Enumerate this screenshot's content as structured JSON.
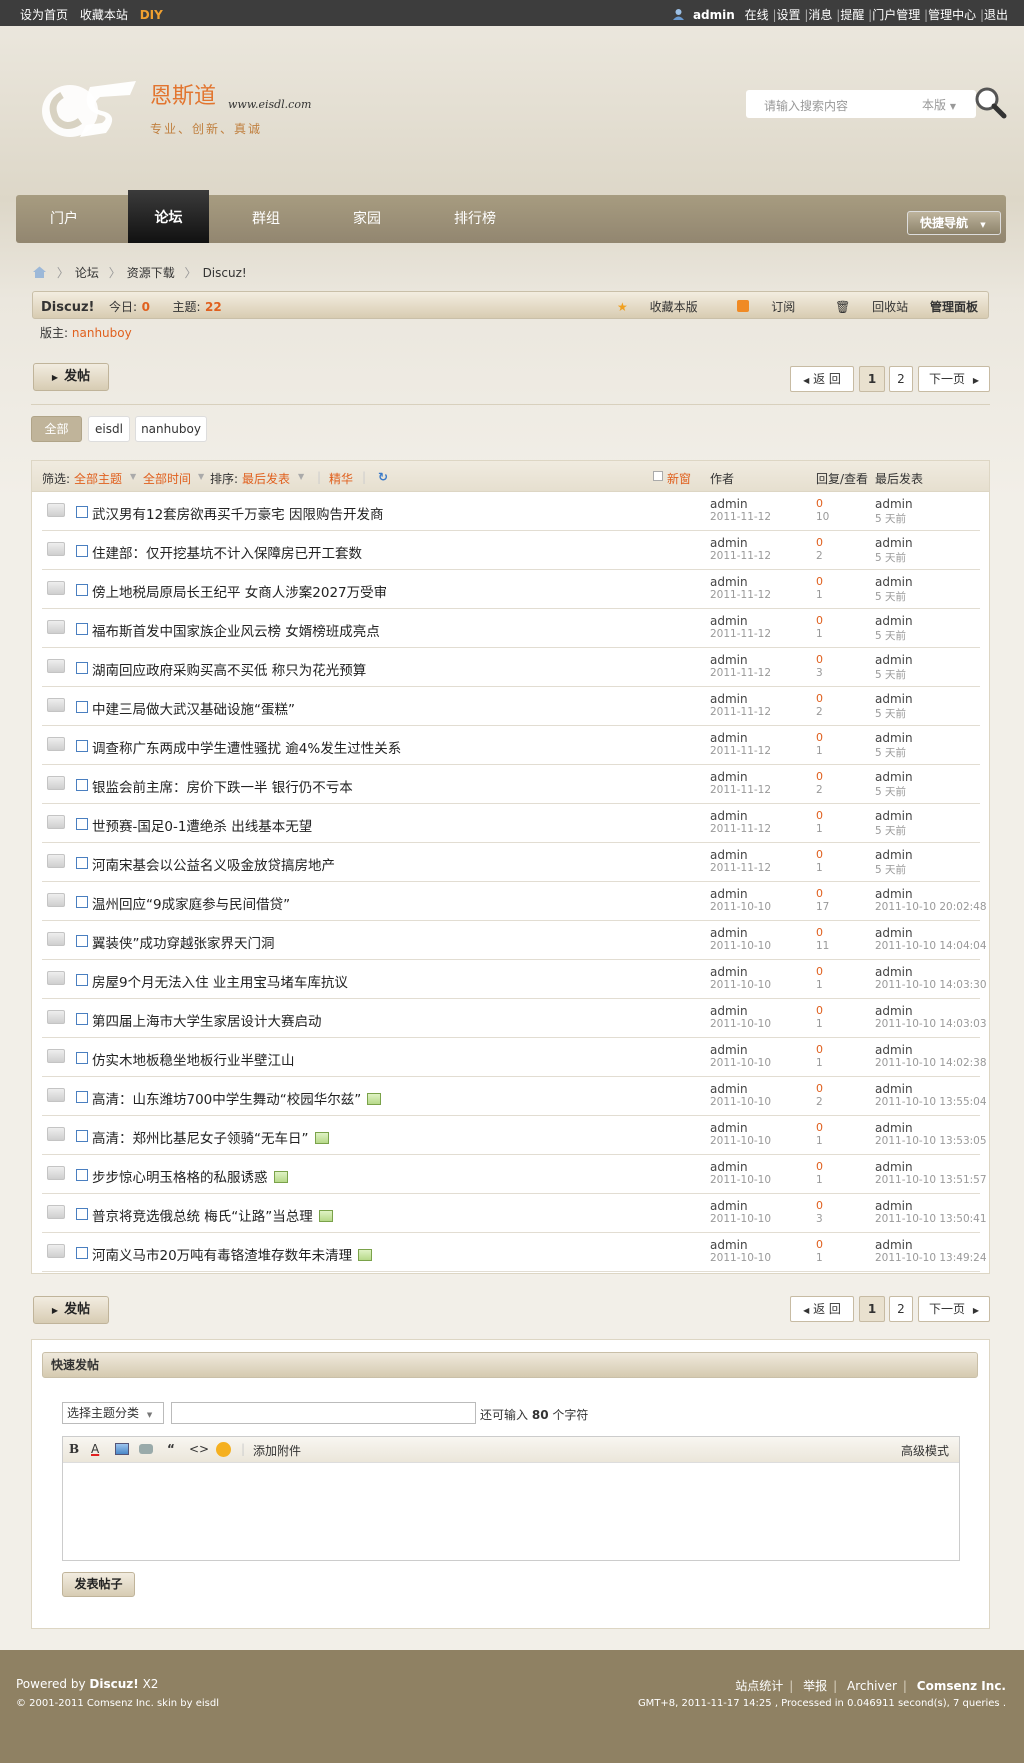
{
  "topbar": {
    "left": [
      "设为首页",
      "收藏本站"
    ],
    "diy": "DIY",
    "username": "admin",
    "status": "在线",
    "links": [
      "设置",
      "消息",
      "提醒",
      "门户管理",
      "管理中心",
      "退出"
    ]
  },
  "header": {
    "site_name": "恩斯道",
    "site_url": "www.eisdl.com",
    "slogan": "专业、创新、真诚",
    "search_placeholder": "请输入搜索内容",
    "search_scope": "本版"
  },
  "nav": {
    "items": [
      "门户",
      "论坛",
      "群组",
      "家园",
      "排行榜"
    ],
    "active": "论坛",
    "quick_nav": "快捷导航"
  },
  "breadcrumb": [
    "论坛",
    "资源下载",
    "Discuz!"
  ],
  "forum": {
    "name": "Discuz!",
    "today_label": "今日:",
    "today": "0",
    "threads_label": "主题:",
    "threads": "22",
    "tools": [
      "收藏本版",
      "订阅",
      "回收站",
      "管理面板"
    ],
    "moderator_label": "版主:",
    "moderator": "nanhuboy"
  },
  "actions": {
    "post": "发帖",
    "back": "返 回",
    "pages": [
      "1",
      "2"
    ],
    "next": "下一页"
  },
  "filter_tabs": [
    "全部",
    "eisdl",
    "nanhuboy"
  ],
  "filter": {
    "label": "筛选:",
    "all_topics": "全部主题",
    "all_time": "全部时间",
    "sort_label": "排序:",
    "sort": "最后发表",
    "digest": "精华",
    "new_window": "新窗",
    "col_author": "作者",
    "col_reply": "回复/查看",
    "col_last": "最后发表"
  },
  "threads": [
    {
      "title": "武汉男有12套房欲再买千万豪宅 因限购告开发商",
      "author": "admin",
      "date": "2011-11-12",
      "replies": "0",
      "views": "10",
      "last_user": "admin",
      "last_time": "5 天前",
      "img": false
    },
    {
      "title": "住建部：仅开挖基坑不计入保障房已开工套数",
      "author": "admin",
      "date": "2011-11-12",
      "replies": "0",
      "views": "2",
      "last_user": "admin",
      "last_time": "5 天前",
      "img": false
    },
    {
      "title": "傍上地税局原局长王纪平 女商人涉案2027万受审",
      "author": "admin",
      "date": "2011-11-12",
      "replies": "0",
      "views": "1",
      "last_user": "admin",
      "last_time": "5 天前",
      "img": false
    },
    {
      "title": "福布斯首发中国家族企业风云榜 女婿榜班成亮点",
      "author": "admin",
      "date": "2011-11-12",
      "replies": "0",
      "views": "1",
      "last_user": "admin",
      "last_time": "5 天前",
      "img": false
    },
    {
      "title": "湖南回应政府采购买高不买低 称只为花光预算",
      "author": "admin",
      "date": "2011-11-12",
      "replies": "0",
      "views": "3",
      "last_user": "admin",
      "last_time": "5 天前",
      "img": false
    },
    {
      "title": "中建三局做大武汉基础设施“蛋糕”",
      "author": "admin",
      "date": "2011-11-12",
      "replies": "0",
      "views": "2",
      "last_user": "admin",
      "last_time": "5 天前",
      "img": false
    },
    {
      "title": "调查称广东两成中学生遭性骚扰 逾4%发生过性关系",
      "author": "admin",
      "date": "2011-11-12",
      "replies": "0",
      "views": "1",
      "last_user": "admin",
      "last_time": "5 天前",
      "img": false
    },
    {
      "title": "银监会前主席：房价下跌一半 银行仍不亏本",
      "author": "admin",
      "date": "2011-11-12",
      "replies": "0",
      "views": "2",
      "last_user": "admin",
      "last_time": "5 天前",
      "img": false
    },
    {
      "title": "世预赛-国足0-1遭绝杀 出线基本无望",
      "author": "admin",
      "date": "2011-11-12",
      "replies": "0",
      "views": "1",
      "last_user": "admin",
      "last_time": "5 天前",
      "img": false
    },
    {
      "title": "河南宋基会以公益名义吸金放贷搞房地产",
      "author": "admin",
      "date": "2011-11-12",
      "replies": "0",
      "views": "1",
      "last_user": "admin",
      "last_time": "5 天前",
      "img": false
    },
    {
      "title": "温州回应“9成家庭参与民间借贷”",
      "author": "admin",
      "date": "2011-10-10",
      "replies": "0",
      "views": "17",
      "last_user": "admin",
      "last_time": "2011-10-10 20:02:48",
      "img": false
    },
    {
      "title": "翼装侠”成功穿越张家界天门洞",
      "author": "admin",
      "date": "2011-10-10",
      "replies": "0",
      "views": "11",
      "last_user": "admin",
      "last_time": "2011-10-10 14:04:04",
      "img": false
    },
    {
      "title": "房屋9个月无法入住 业主用宝马堵车库抗议",
      "author": "admin",
      "date": "2011-10-10",
      "replies": "0",
      "views": "1",
      "last_user": "admin",
      "last_time": "2011-10-10 14:03:30",
      "img": false
    },
    {
      "title": "第四届上海市大学生家居设计大赛启动",
      "author": "admin",
      "date": "2011-10-10",
      "replies": "0",
      "views": "1",
      "last_user": "admin",
      "last_time": "2011-10-10 14:03:03",
      "img": false
    },
    {
      "title": "仿实木地板稳坐地板行业半壁江山",
      "author": "admin",
      "date": "2011-10-10",
      "replies": "0",
      "views": "1",
      "last_user": "admin",
      "last_time": "2011-10-10 14:02:38",
      "img": false
    },
    {
      "title": "高清：山东潍坊700中学生舞动“校园华尔兹”",
      "author": "admin",
      "date": "2011-10-10",
      "replies": "0",
      "views": "2",
      "last_user": "admin",
      "last_time": "2011-10-10 13:55:04",
      "img": true
    },
    {
      "title": "高清：郑州比基尼女子领骑“无车日”",
      "author": "admin",
      "date": "2011-10-10",
      "replies": "0",
      "views": "1",
      "last_user": "admin",
      "last_time": "2011-10-10 13:53:05",
      "img": true
    },
    {
      "title": "步步惊心明玉格格的私服诱惑",
      "author": "admin",
      "date": "2011-10-10",
      "replies": "0",
      "views": "1",
      "last_user": "admin",
      "last_time": "2011-10-10 13:51:57",
      "img": true
    },
    {
      "title": "普京将竞选俄总统 梅氏“让路”当总理",
      "author": "admin",
      "date": "2011-10-10",
      "replies": "0",
      "views": "3",
      "last_user": "admin",
      "last_time": "2011-10-10 13:50:41",
      "img": true
    },
    {
      "title": "河南义马市20万吨有毒铬渣堆存数年未清理",
      "author": "admin",
      "date": "2011-10-10",
      "replies": "0",
      "views": "1",
      "last_user": "admin",
      "last_time": "2011-10-10 13:49:24",
      "img": true
    }
  ],
  "fastpost": {
    "title": "快速发帖",
    "type_select": "选择主题分类",
    "remain_prefix": "还可输入",
    "remain": "80",
    "remain_suffix": "个字符",
    "attach": "添加附件",
    "advanced": "高级模式",
    "submit": "发表帖子"
  },
  "footer": {
    "powered_prefix": "Powered by",
    "product": "Discuz!",
    "version": "X2",
    "copyright": "© 2001-2011 Comsenz Inc. skin by eisdl",
    "links": [
      "站点统计",
      "举报",
      "Archiver"
    ],
    "company": "Comsenz Inc.",
    "stats": "GMT+8, 2011-11-17 14:25 , Processed in 0.046911 second(s), 7 queries ."
  },
  "colors": {
    "accent": "#e0601e",
    "nav": "#9a8f76",
    "footer": "#8f8163"
  }
}
